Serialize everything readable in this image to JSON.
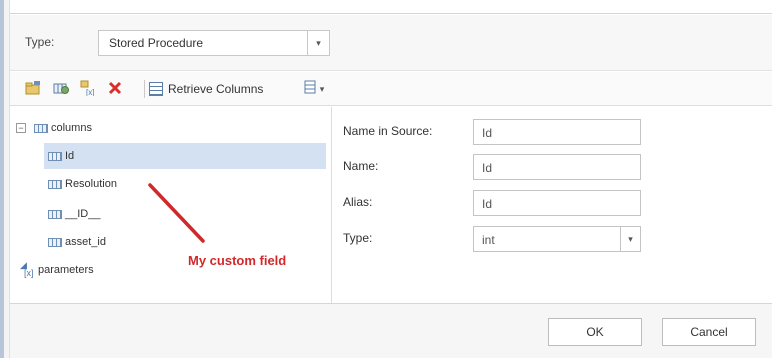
{
  "type_row": {
    "label": "Type:",
    "selected": "Stored Procedure",
    "arrow": "▾"
  },
  "toolbar": {
    "icons": [
      "add-folder-icon",
      "add-column-icon",
      "add-parameter-icon",
      "delete-icon"
    ],
    "retrieve_label": "Retrieve Columns",
    "menu_icon": "table-menu-icon",
    "menu_arrow": "▾"
  },
  "tree": {
    "root_label": "columns",
    "expander": "−",
    "items": [
      {
        "label": "Id"
      },
      {
        "label": "Resolution"
      },
      {
        "label": "__ID__"
      },
      {
        "label": "asset_id"
      }
    ],
    "parameters_label": "parameters"
  },
  "annotation": {
    "text": "My custom field",
    "color": "#d0292b"
  },
  "properties": {
    "name_in_source_label": "Name in Source:",
    "name_in_source_value": "Id",
    "name_label": "Name:",
    "name_value": "Id",
    "alias_label": "Alias:",
    "alias_value": "Id",
    "type_label": "Type:",
    "type_value": "int",
    "type_arrow": "▾"
  },
  "footer": {
    "ok_label": "OK",
    "cancel_label": "Cancel"
  },
  "colors": {
    "selection": "#d4e1f2",
    "delete_red": "#d9302c",
    "accent_blue": "#4a78b0"
  }
}
